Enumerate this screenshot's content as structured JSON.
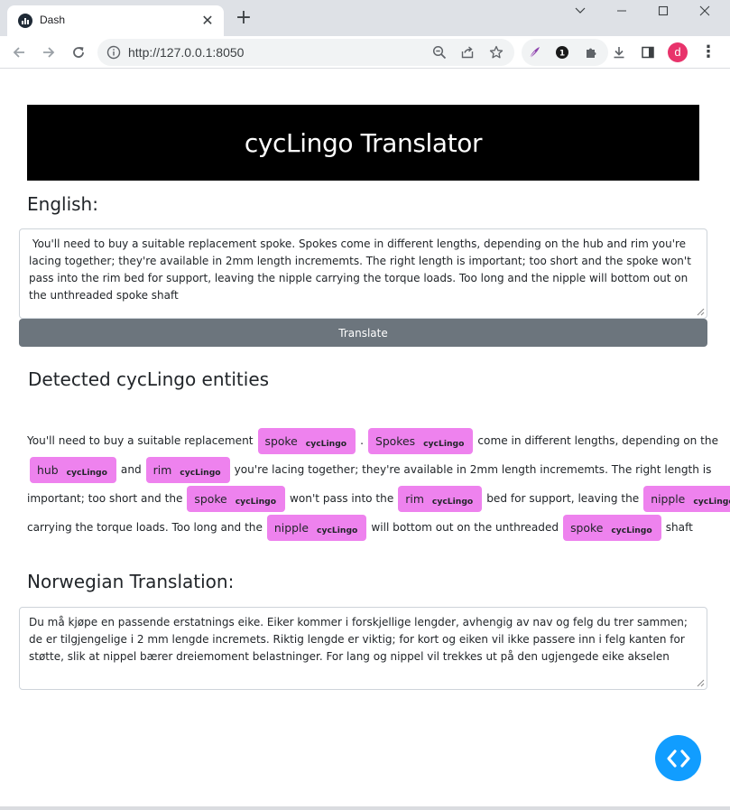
{
  "browser": {
    "tab_title": "Dash",
    "tab_close": "✕",
    "new_tab": "+",
    "url": "http://127.0.0.1:8050",
    "profile_initial": "d",
    "extension_badge": "1"
  },
  "header": {
    "title": "cycLingo Translator"
  },
  "english": {
    "label": "English:",
    "text": " You'll need to buy a suitable replacement spoke. Spokes come in different lengths, depending on the hub and rim you're lacing together; they're available in 2mm length incrememts. The right length is important; too short and the spoke won't pass into the rim bed for support, leaving the nipple carrying the torque loads. Too long and the nipple will bottom out on the unthreaded spoke shaft"
  },
  "translate_button": "Translate",
  "entities": {
    "title": "Detected cycLingo entities",
    "lines": [
      [
        {
          "t": "text",
          "v": "You'll need to buy a suitable replacement"
        },
        {
          "t": "ent",
          "v": "spoke",
          "label": "cycLingo"
        },
        {
          "t": "text",
          "v": "."
        },
        {
          "t": "ent",
          "v": "Spokes",
          "label": "cycLingo"
        },
        {
          "t": "text",
          "v": "come in different lengths, depending on the"
        }
      ],
      [
        {
          "t": "ent",
          "v": "hub",
          "label": "cycLingo"
        },
        {
          "t": "text",
          "v": "and"
        },
        {
          "t": "ent",
          "v": "rim",
          "label": "cycLingo"
        },
        {
          "t": "text",
          "v": "you're lacing together; they're available in 2mm length incrememts. The right length is"
        }
      ],
      [
        {
          "t": "text",
          "v": "important; too short and the"
        },
        {
          "t": "ent",
          "v": "spoke",
          "label": "cycLingo"
        },
        {
          "t": "text",
          "v": "won't pass into the"
        },
        {
          "t": "ent",
          "v": "rim",
          "label": "cycLingo"
        },
        {
          "t": "text",
          "v": "bed for support, leaving the"
        },
        {
          "t": "ent",
          "v": "nipple",
          "label": "cycLingo"
        }
      ],
      [
        {
          "t": "text",
          "v": "carrying the torque loads. Too long and the"
        },
        {
          "t": "ent",
          "v": "nipple",
          "label": "cycLingo"
        },
        {
          "t": "text",
          "v": "will bottom out on the unthreaded"
        },
        {
          "t": "ent",
          "v": "spoke",
          "label": "cycLingo"
        },
        {
          "t": "text",
          "v": "shaft"
        }
      ]
    ]
  },
  "norwegian": {
    "label": "Norwegian Translation:",
    "text": "Du må kjøpe en passende erstatnings eike. Eiker kommer i forskjellige lengder, avhengig av nav og felg du trer sammen; de er tilgjengelige i 2 mm lengde incremets. Riktig lengde er viktig; for kort og eiken vil ikke passere inn i felg kanten for støtte, slik at nippel bærer dreiemoment belastninger. For lang og nippel vil trekkes ut på den ugjengede eike akselen"
  },
  "colors": {
    "entity_bg": "#ee82ee",
    "header_bg": "#000000",
    "button_bg": "#6c757d",
    "fab_bg": "#119dff"
  }
}
